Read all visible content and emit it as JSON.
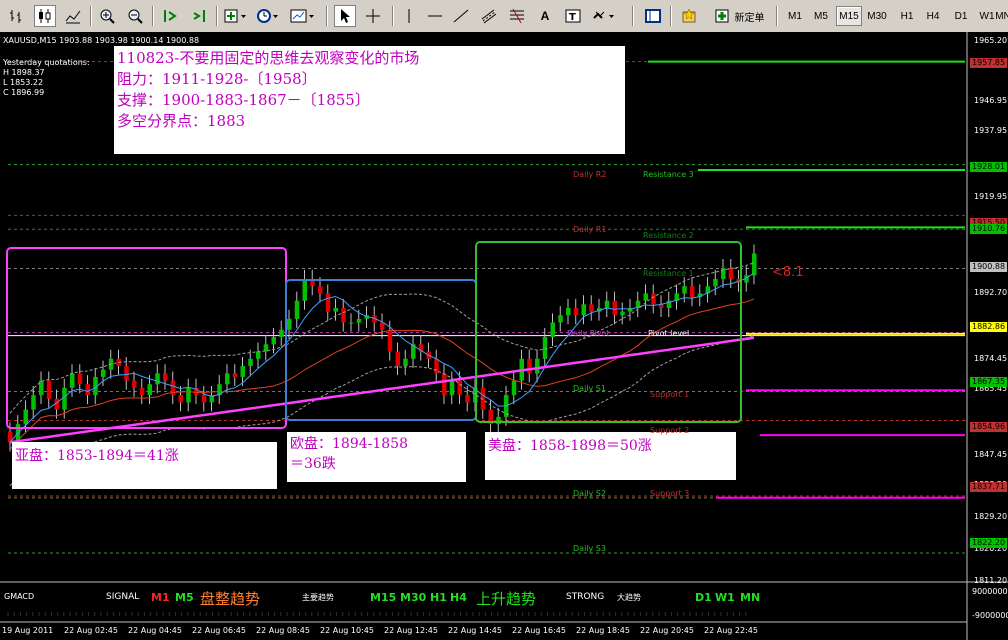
{
  "toolbar": {
    "new_order_label": "新定单",
    "timeframes": [
      "M1",
      "M5",
      "M15",
      "M30",
      "H1",
      "H4",
      "D1",
      "W1",
      "MN"
    ],
    "active_timeframe": "M15",
    "text_tool": "A"
  },
  "chart": {
    "symbol_line": "XAUUSD,M15  1903.88 1903.98 1900.14 1900.88",
    "yesterday_title": "Yesterday quotations:",
    "yesterday": [
      "H 1898.37",
      "L 1853.22",
      "C 1896.99"
    ],
    "price_ticks": [
      "1965.20",
      "1946.95",
      "1937.95",
      "1919.95",
      "1910.95",
      "1892.70",
      "1874.45",
      "1865.45",
      "1847.45",
      "1838.20",
      "1829.20",
      "1820.20",
      "1811.20"
    ],
    "price_tags": [
      {
        "text": "1957.85",
        "color": "#c03030"
      },
      {
        "text": "1928.01",
        "color": "#00c000"
      },
      {
        "text": "1915.50",
        "color": "#c03030"
      },
      {
        "text": "1910.76",
        "color": "#00c000"
      },
      {
        "text": "1900.88",
        "color": "#c0c0c0"
      },
      {
        "text": "1882.86",
        "color": "#ffff00"
      },
      {
        "text": "1867.35",
        "color": "#00c000"
      },
      {
        "text": "1854.96",
        "color": "#c03030"
      },
      {
        "text": "1837.71",
        "color": "#c03030"
      },
      {
        "text": "1822.20",
        "color": "#00c000"
      }
    ],
    "time_labels": [
      "19 Aug 2011",
      "22 Aug 02:45",
      "22 Aug 04:45",
      "22 Aug 06:45",
      "22 Aug 08:45",
      "22 Aug 10:45",
      "22 Aug 12:45",
      "22 Aug 14:45",
      "22 Aug 16:45",
      "22 Aug 18:45",
      "22 Aug 20:45",
      "22 Aug 22:45"
    ],
    "pivot_labels": {
      "daily_r2": "Daily R2",
      "resistance3": "Resistance 3",
      "daily_r1": "Daily R1",
      "resistance2": "Resistance 2",
      "resistance1": "Resistance 1",
      "daily_pivot": "Daily Pivot",
      "pivot_level": "Pivot level",
      "daily_s1": "Daily S1",
      "support1": "Support 1",
      "support2": "Support 2",
      "daily_s2": "Daily S2",
      "support3": "Support 3",
      "daily_s3": "Daily S3"
    },
    "price_marker": "<8.1",
    "note_main": [
      "110823-不要用固定的思维去观察变化的市场",
      "阻力：1911-1928-〔1958〕",
      "支撑：1900-1883-1867－〔1855〕",
      "多空分界点：1883"
    ],
    "note_asia": "亚盘：1853-1894＝41涨",
    "note_europe": [
      "欧盘：1894-1858",
      "＝36跌"
    ],
    "note_us": "美盘：1858-1898＝50涨"
  },
  "indicator": {
    "name": "GMACD",
    "signal": "SIGNAL",
    "m1": "M1",
    "m5": "M5",
    "consolidation": "盘整趋势",
    "main_trend": "主要趋势",
    "m15": "M15",
    "m30": "M30",
    "h1": "H1",
    "h4": "H4",
    "uptrend": "上升趋势",
    "strong": "STRONG",
    "big_trend": "大趋势",
    "d1": "D1",
    "w1": "W1",
    "mn": "MN",
    "ticks": [
      "9000000",
      "-9000000"
    ]
  },
  "colors": {
    "bull": "#00c000",
    "bear": "#e00000",
    "magenta": "#ff00ff",
    "blue_box": "#3a7fd0",
    "green_box": "#30c030"
  }
}
